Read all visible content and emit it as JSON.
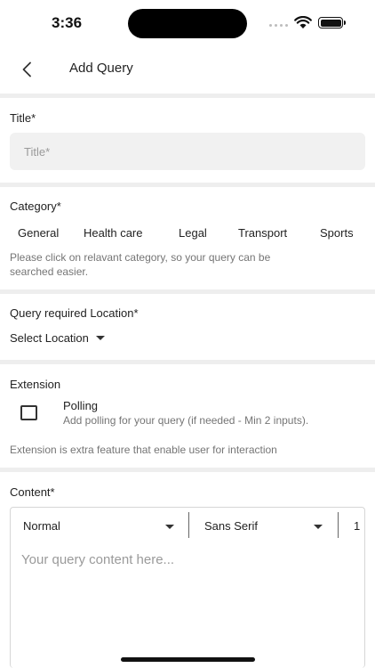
{
  "status_bar": {
    "time": "3:36"
  },
  "header": {
    "title": "Add Query"
  },
  "title_section": {
    "label": "Title*",
    "placeholder": "Title*"
  },
  "category_section": {
    "label": "Category*",
    "categories": [
      "General",
      "Health care",
      "Legal",
      "Transport",
      "Sports"
    ],
    "hint_line1": "Please click on relavant category, so your query can be",
    "hint_line2": "searched easier."
  },
  "location_section": {
    "label": "Query required Location*",
    "select_label": "Select Location"
  },
  "extension_section": {
    "label": "Extension",
    "polling_title": "Polling",
    "polling_subtitle": "Add polling for your query (if needed - Min 2 inputs).",
    "note": "Extension is extra feature that enable user for interaction"
  },
  "content_section": {
    "label": "Content*",
    "format_select": "Normal",
    "font_select": "Sans Serif",
    "size_select": "1",
    "placeholder": "Your query content here..."
  }
}
